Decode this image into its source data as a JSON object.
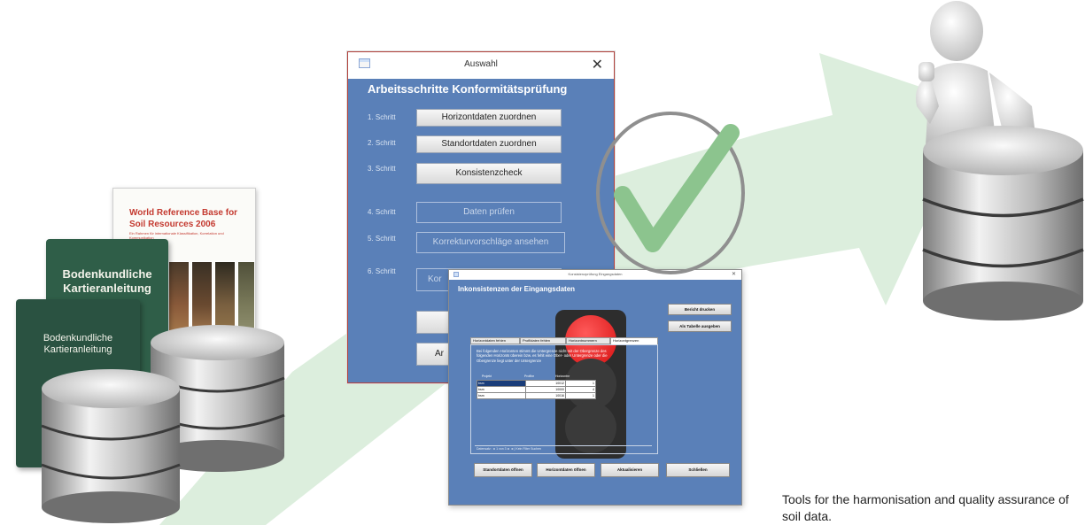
{
  "colors": {
    "arrow": "#dceedd",
    "dialog_blue": "#5a80b8",
    "check_green": "#8cc48e",
    "wrb_red": "#c43a30",
    "book_green": "#2f5e48",
    "traffic_red": "#ee2222"
  },
  "icons": [
    "database-icon",
    "checkmark-icon",
    "thumbs-up-figure",
    "window-icon",
    "close-icon"
  ],
  "books": {
    "wrb": {
      "title": "World Reference Base for Soil Resources 2006",
      "subtitle": "Ein Rahmen für internationale Klassifikation, Korrelation und Kommunikation"
    },
    "book1": "Bodenkundliche Kartieranleitung",
    "book2": "Bodenkundliche Kartieranleitung"
  },
  "auswahl": {
    "title": "Auswahl",
    "close": "✕",
    "heading": "Arbeitsschritte Konformitätsprüfung",
    "steps": [
      {
        "label": "1. Schritt",
        "button": "Horizontdaten zuordnen",
        "enabled": true
      },
      {
        "label": "2. Schritt",
        "button": "Standortdaten zuordnen",
        "enabled": true
      },
      {
        "label": "3. Schritt",
        "button": "Konsistenzcheck",
        "enabled": true
      },
      {
        "label": "4. Schritt",
        "button": "Daten prüfen",
        "enabled": false
      },
      {
        "label": "5. Schritt",
        "button": "Korrekturvorschläge ansehen",
        "enabled": false
      },
      {
        "label": "6. Schritt",
        "button": "Kor",
        "enabled": false
      }
    ],
    "extra_buttons": [
      "",
      "Ar"
    ]
  },
  "inkonsistenzen": {
    "title": "Konsistenzprüfung Eingangsdaten",
    "close": "✕",
    "heading": "Inkonsistenzen der Eingangsdaten",
    "side_buttons": [
      "Bericht drucken",
      "Als Tabelle ausgeben"
    ],
    "tabs": [
      "Horizontdaten fehlen",
      "Profildaten fehlen",
      "Horizontnummern",
      "Horizontgrenzen"
    ],
    "active_tab": 3,
    "message": "Bei folgenden Horizonten stimmt die Untergrenze nicht mit der Obergrenze des folgenden Horizonts überein bzw. es fehlt eine Ober- oder Untergrenze oder die Obergrenze liegt unter der Untergrenze",
    "columns": [
      "Projekt",
      "Profilnr",
      "Horizontnr"
    ],
    "rows": [
      {
        "projekt": "bsm",
        "profil": "10012",
        "horizont": "1"
      },
      {
        "projekt": "bsm",
        "profil": "10000",
        "horizont": "4"
      },
      {
        "projekt": "bsm",
        "profil": "10016",
        "horizont": "1"
      }
    ],
    "nav_text": "Datensatz: ◄  1 von 3  ► ►|  Kein Filter   Suchen",
    "bottom_buttons": [
      "Standortdaten öffnen",
      "Horizontdaten öffnen",
      "Aktualisieren",
      "Schließen"
    ]
  },
  "caption": "Tools for the harmonisation and quality assurance of soil data."
}
